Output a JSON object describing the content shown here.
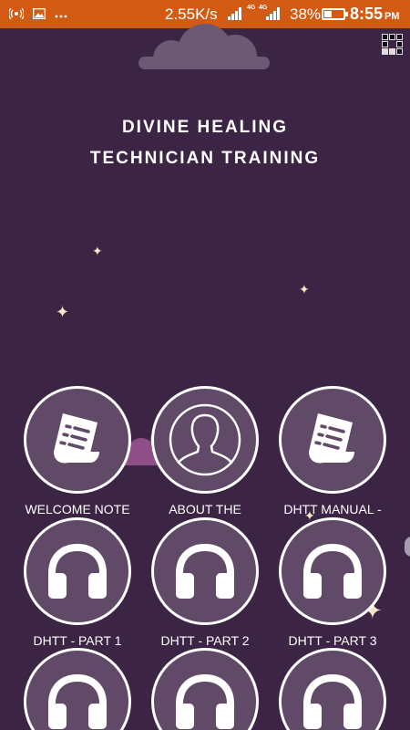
{
  "status_bar": {
    "speed": "2.55K/s",
    "net_label_1": "4G",
    "net_label_2": "4G",
    "battery_pct": "38%",
    "time": "8:55",
    "ampm": "PM"
  },
  "app": {
    "title_line1": "DIVINE HEALING",
    "title_line2": "TECHNICIAN TRAINING"
  },
  "colors": {
    "background": "#3c2444",
    "status_bar": "#d35a12",
    "tile_fill": "#614968",
    "star": "#f7e7c3"
  },
  "tiles": [
    {
      "label": "WELCOME NOTE",
      "icon": "document-icon"
    },
    {
      "label": "ABOUT THE",
      "icon": "person-icon"
    },
    {
      "label": "DHTT MANUAL -",
      "icon": "document-icon"
    },
    {
      "label": "DHTT - PART 1",
      "icon": "headphones-icon"
    },
    {
      "label": "DHTT - PART 2",
      "icon": "headphones-icon"
    },
    {
      "label": "DHTT - PART 3",
      "icon": "headphones-icon"
    },
    {
      "label": "",
      "icon": "headphones-icon"
    },
    {
      "label": "",
      "icon": "headphones-icon"
    },
    {
      "label": "",
      "icon": "headphones-icon"
    }
  ]
}
